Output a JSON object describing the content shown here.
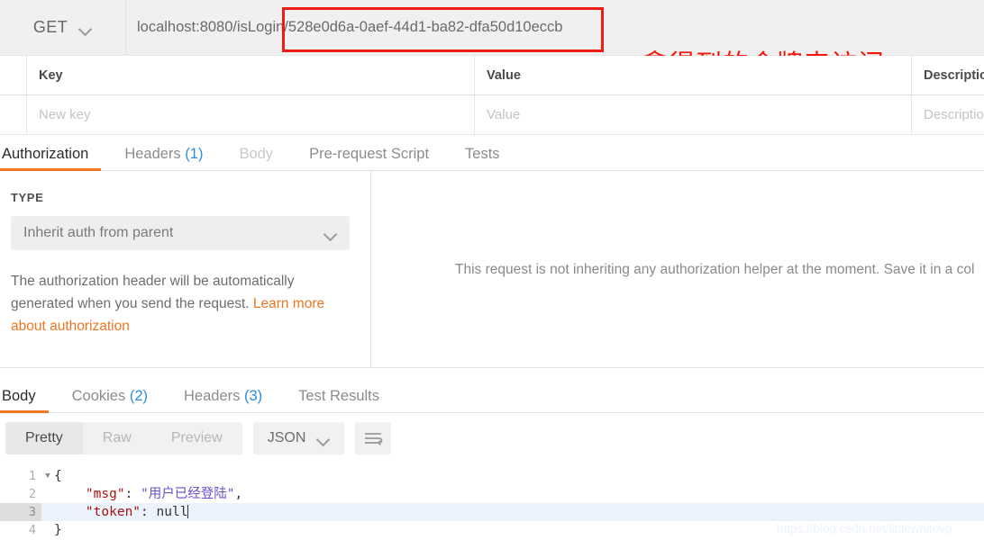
{
  "request_bar": {
    "method": "GET",
    "method_chevron_icon": "chevron-down-icon",
    "url_base": "localhost:8080/isLogin/",
    "url_token": "528e0d6a-0aef-44d1-ba82-dfa50d10eccb",
    "url_full": "localhost:8080/isLogin/528e0d6a-0aef-44d1-ba82-dfa50d10eccb",
    "annotation_note": "拿得到的令牌来访问",
    "annotation_color": "#f5170d",
    "highlight_box_color": "#ee1c15"
  },
  "params_table": {
    "headers": [
      "",
      "Key",
      "Value",
      "Description"
    ],
    "rows": [
      {
        "check": "",
        "key": "New key",
        "value": "Value",
        "description": "Description"
      }
    ]
  },
  "request_tabs": [
    {
      "label": "Authorization",
      "count": "",
      "active": true,
      "dim": false
    },
    {
      "label": "Headers",
      "count": "(1)",
      "active": false,
      "dim": false
    },
    {
      "label": "Body",
      "count": "",
      "active": false,
      "dim": true
    },
    {
      "label": "Pre-request Script",
      "count": "",
      "active": false,
      "dim": false
    },
    {
      "label": "Tests",
      "count": "",
      "active": false,
      "dim": false
    }
  ],
  "auth_panel": {
    "type_label": "TYPE",
    "type_value": "Inherit auth from parent",
    "type_chevron_icon": "chevron-down-icon",
    "description_text": "The authorization header will be automatically generated when you send the request. ",
    "description_link": "Learn more about authorization",
    "link_color": "#ef7722",
    "right_message": "This request is not inheriting any authorization helper at the moment. Save it in a col"
  },
  "response_tabs": [
    {
      "label": "Body",
      "count": "",
      "active": true
    },
    {
      "label": "Cookies",
      "count": "(2)",
      "active": false
    },
    {
      "label": "Headers",
      "count": "(3)",
      "active": false
    },
    {
      "label": "Test Results",
      "count": "",
      "active": false
    }
  ],
  "response_toolbar": {
    "view_modes": [
      {
        "label": "Pretty",
        "active": true
      },
      {
        "label": "Raw",
        "active": false
      },
      {
        "label": "Preview",
        "active": false
      }
    ],
    "format": "JSON",
    "format_chevron_icon": "chevron-down-icon",
    "wrap_icon": "word-wrap-icon"
  },
  "response_body": {
    "language": "json",
    "lines": [
      {
        "num": "1",
        "foldable": true,
        "highlight": false,
        "segments": [
          {
            "text": "{",
            "cls": "tk-punc"
          }
        ]
      },
      {
        "num": "2",
        "foldable": false,
        "highlight": false,
        "segments": [
          {
            "text": "    ",
            "cls": "tk-punc"
          },
          {
            "text": "\"msg\"",
            "cls": "tk-key"
          },
          {
            "text": ": ",
            "cls": "tk-punc"
          },
          {
            "text": "\"用户已经登陆\"",
            "cls": "tk-str"
          },
          {
            "text": ",",
            "cls": "tk-punc"
          }
        ]
      },
      {
        "num": "3",
        "foldable": false,
        "highlight": true,
        "segments": [
          {
            "text": "    ",
            "cls": "tk-punc"
          },
          {
            "text": "\"token\"",
            "cls": "tk-key"
          },
          {
            "text": ": ",
            "cls": "tk-punc"
          },
          {
            "text": "null",
            "cls": "tk-null"
          }
        ]
      },
      {
        "num": "4",
        "foldable": false,
        "highlight": false,
        "segments": [
          {
            "text": "}",
            "cls": "tk-punc"
          }
        ]
      }
    ],
    "raw_text": "{\n    \"msg\": \"用户已经登陆\",\n    \"token\": null\n}"
  },
  "watermark": "https://blog.csdn.net/littlewhitevg"
}
